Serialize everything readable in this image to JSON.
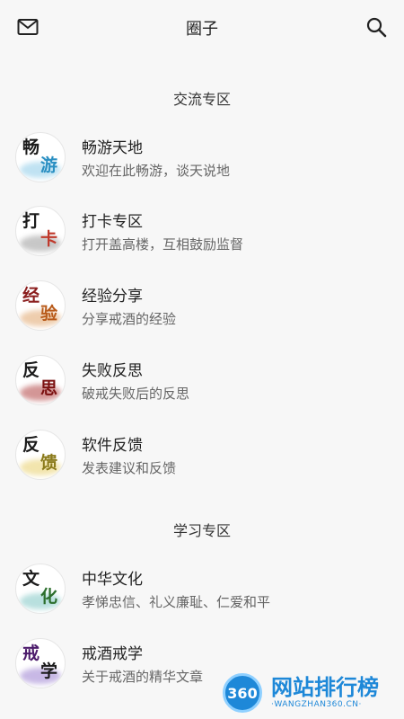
{
  "header": {
    "title": "圈子",
    "left_icon": "mail-icon",
    "right_icon": "search-icon"
  },
  "sections": [
    {
      "title": "交流专区",
      "items": [
        {
          "title": "畅游天地",
          "subtitle": "欢迎在此畅游，谈天说地",
          "avatar_chars": [
            "畅",
            "游"
          ],
          "avatar_colors": [
            "#1b1b1b",
            "#2a8fc2"
          ],
          "wash_color": "#8ccbe8"
        },
        {
          "title": "打卡专区",
          "subtitle": "打开盖高楼，互相鼓励监督",
          "avatar_chars": [
            "打",
            "卡"
          ],
          "avatar_colors": [
            "#1b1b1b",
            "#c0392b"
          ],
          "wash_color": "#9a9a9a"
        },
        {
          "title": "经验分享",
          "subtitle": "分享戒酒的经验",
          "avatar_chars": [
            "经",
            "验"
          ],
          "avatar_colors": [
            "#8b1e1e",
            "#b85a1a"
          ],
          "wash_color": "#e0a46a"
        },
        {
          "title": "失败反思",
          "subtitle": "破戒失败后的反思",
          "avatar_chars": [
            "反",
            "思"
          ],
          "avatar_colors": [
            "#1b1b1b",
            "#7b1010"
          ],
          "wash_color": "#b04040"
        },
        {
          "title": "软件反馈",
          "subtitle": "发表建议和反馈",
          "avatar_chars": [
            "反",
            "馈"
          ],
          "avatar_colors": [
            "#1b1b1b",
            "#8a7a1a"
          ],
          "wash_color": "#e8cf6a"
        }
      ]
    },
    {
      "title": "学习专区",
      "items": [
        {
          "title": "中华文化",
          "subtitle": "孝悌忠信、礼义廉耻、仁爱和平",
          "avatar_chars": [
            "文",
            "化"
          ],
          "avatar_colors": [
            "#1b1b1b",
            "#2c6e2c"
          ],
          "wash_color": "#7fc6c4"
        },
        {
          "title": "戒酒戒学",
          "subtitle": "关于戒酒的精华文章",
          "avatar_chars": [
            "戒",
            "学"
          ],
          "avatar_colors": [
            "#4b1a6b",
            "#1b1b1b"
          ],
          "wash_color": "#9b7fd0"
        }
      ]
    }
  ],
  "watermark": {
    "badge": "360",
    "main": "网站排行榜",
    "sub": "·WANGZHAN360.CN·"
  }
}
